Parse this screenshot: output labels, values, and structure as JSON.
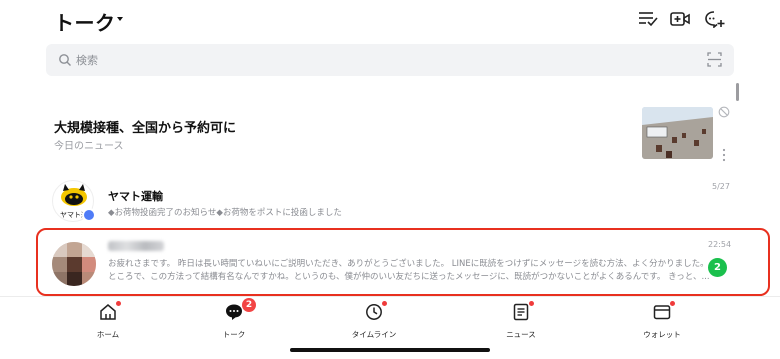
{
  "header": {
    "title": "トーク",
    "icons": [
      "edit-list-icon",
      "video-plus-icon",
      "chat-plus-icon"
    ]
  },
  "search": {
    "placeholder": "検索"
  },
  "news": {
    "headline": "大規模接種、全国から予約可に",
    "source": "今日のニュース"
  },
  "chats": [
    {
      "name": "ヤマト運輸",
      "message": "◆お荷物投函完了のお知らせ◆お荷物をポストに投函しました",
      "time": "5/27",
      "avatar_label": "ヤマト運"
    },
    {
      "name": "",
      "message_line1": "お疲れさまです。 昨日は長い時間ていねいにご説明いただき、ありがとうございました。 LINEに既読をつけずにメッセージを読む方法、よく分かりました。",
      "message_line2": "ところで、この方法って結構有名なんですかね。というのも、僕が仲のいい友だちに送ったメッセージに、既読がつかないことがよくあるんです。 きっと、...",
      "time": "22:54",
      "unread": "2"
    }
  ],
  "tabbar": {
    "tabs": [
      {
        "label": "ホーム",
        "icon": "home-icon",
        "badge": "dot"
      },
      {
        "label": "トーク",
        "icon": "talk-icon",
        "badge": "2"
      },
      {
        "label": "タイムライン",
        "icon": "clock-icon",
        "badge": "dot"
      },
      {
        "label": "ニュース",
        "icon": "news-icon",
        "badge": "dot"
      },
      {
        "label": "ウォレット",
        "icon": "wallet-icon",
        "badge": "dot"
      }
    ]
  },
  "colors": {
    "accent_green": "#1ac04d",
    "badge_red": "#f24444",
    "highlight_red": "#e8301f"
  }
}
